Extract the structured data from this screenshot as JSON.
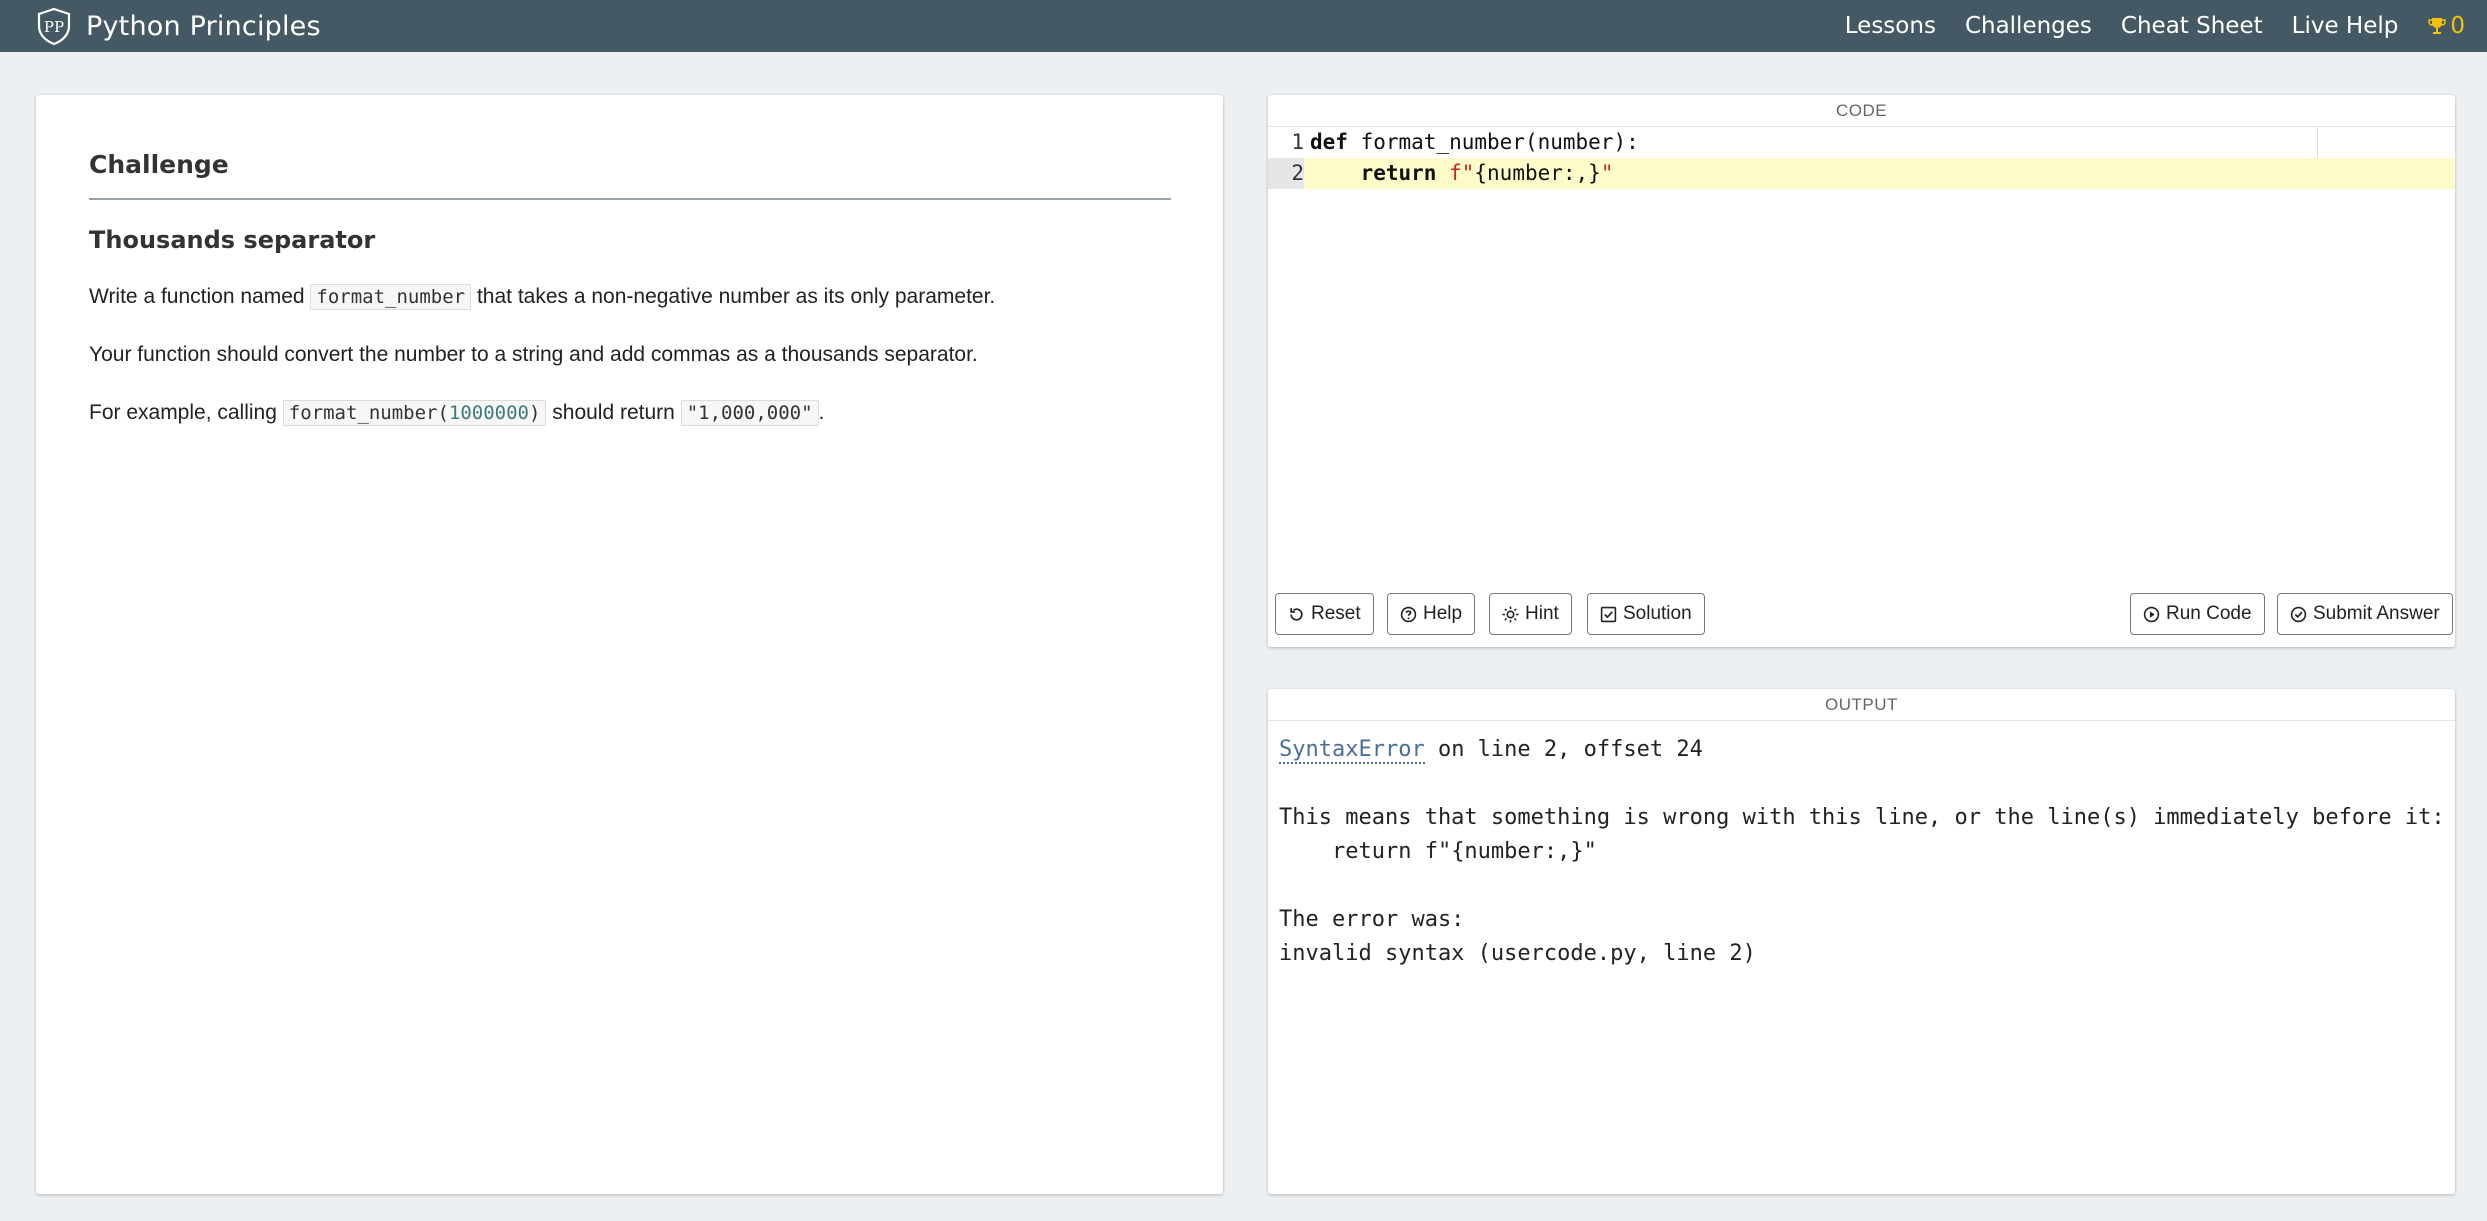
{
  "navbar": {
    "brand_name": "Python Principles",
    "links": [
      "Lessons",
      "Challenges",
      "Cheat Sheet",
      "Live Help"
    ],
    "trophy_count": "0"
  },
  "challenge": {
    "heading": "Challenge",
    "title": "Thousands separator",
    "p1_pre": "Write a function named ",
    "p1_code": "format_number",
    "p1_post": " that takes a non-negative number as its only parameter.",
    "p2": "Your function should convert the number to a string and add commas as a thousands separator.",
    "p3_pre": "For example, calling ",
    "p3_code_fn": "format_number(",
    "p3_code_num": "1000000",
    "p3_code_close": ")",
    "p3_mid": " should return ",
    "p3_code_str": "\"1,000,000\"",
    "p3_post": "."
  },
  "code_panel": {
    "header": "CODE",
    "lines": [
      {
        "num": "1",
        "kw": "def",
        "rest": " format_number(number):"
      },
      {
        "num": "2",
        "indent": "    ",
        "kw": "return",
        "sp": " ",
        "fstr_prefix": "f\"",
        "fstr_body": "{number:,}",
        "fstr_end": "\""
      }
    ],
    "buttons": {
      "reset": "Reset",
      "help": "Help",
      "hint": "Hint",
      "solution": "Solution",
      "run": "Run Code",
      "submit": "Submit Answer"
    }
  },
  "output_panel": {
    "header": "OUTPUT",
    "error_name": "SyntaxError",
    "error_loc": " on line 2, offset 24",
    "explanation": "This means that something is wrong with this line, or the line(s) immediately before it:",
    "code_line": "    return f\"{number:,}\"",
    "error_was": "The error was:",
    "error_detail": "invalid syntax (usercode.py, line 2)"
  }
}
